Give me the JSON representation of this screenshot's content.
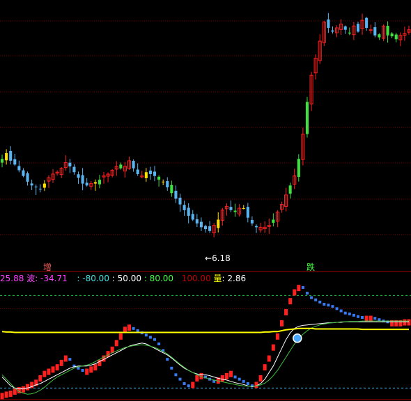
{
  "colors": {
    "background": "#000000",
    "grid": "#7a0000",
    "divider": "#a00000",
    "up": "#ff2020",
    "down": "#5ab4f0",
    "highlight_yellow": "#ffe000",
    "highlight_green": "#40e040",
    "white_line": "#ffffff",
    "green_line": "#40c040",
    "yellow_line": "#ffff00",
    "level_green": "#20c040",
    "level_cyan": "#40c0ff",
    "label_magenta": "#ff40ff",
    "label_cyan": "#40e0e0",
    "label_white": "#ffffff",
    "label_green": "#40ff40",
    "label_red": "#c00000"
  },
  "price_panel": {
    "min_price_label": "6.18",
    "min_marker": "←"
  },
  "signals": {
    "increase_label": "增",
    "fall_label": "跌"
  },
  "indicator_header": {
    "value1": "25.88",
    "wave_name": "波",
    "wave_value": ": -34.71",
    "level_m80": ": -80.00",
    "level_50": ": 50.00",
    "level_80": ": 80.00",
    "level_100": "100.00",
    "volume_name": "量",
    "volume_value": ": 2.86"
  },
  "chart_data": [
    {
      "type": "candlestick",
      "title": "",
      "y_min_marked": 6.18,
      "bars": 97,
      "closes": [
        10.2,
        10.5,
        10.1,
        9.9,
        9.6,
        9.3,
        9.0,
        8.8,
        8.7,
        8.6,
        8.9,
        9.2,
        9.4,
        9.5,
        9.7,
        10.0,
        9.8,
        9.5,
        9.2,
        8.9,
        8.8,
        8.9,
        8.9,
        9.1,
        9.3,
        9.4,
        9.6,
        9.8,
        9.7,
        9.8,
        10.1,
        9.7,
        9.4,
        9.3,
        9.5,
        9.4,
        9.3,
        9.1,
        9.0,
        8.7,
        8.4,
        8.1,
        7.8,
        7.5,
        7.2,
        7.0,
        6.8,
        6.6,
        6.5,
        6.4,
        6.7,
        7.0,
        7.5,
        7.7,
        7.5,
        7.4,
        7.6,
        7.6,
        7.1,
        6.8,
        6.6,
        6.6,
        6.6,
        6.7,
        7.0,
        7.4,
        7.8,
        8.3,
        8.8,
        9.3,
        10.2,
        11.5,
        13.2,
        14.6,
        15.5,
        16.4,
        17.4,
        17.1,
        16.9,
        17.1,
        17.3,
        17.0,
        16.8,
        17.2,
        16.9,
        17.5,
        17.1,
        17.0,
        16.7,
        16.6,
        17.2,
        16.7,
        16.8,
        16.5,
        16.7,
        16.8,
        17.0
      ]
    },
    {
      "type": "line",
      "title": "",
      "levels": [
        -80,
        50,
        80,
        100
      ],
      "series": [
        {
          "color": "histogram",
          "values": [
            -95,
            -92,
            -90,
            -85,
            -82,
            -80,
            -75,
            -70,
            -65,
            -55,
            -45,
            -40,
            -35,
            -30,
            -20,
            -10,
            -15,
            -30,
            -35,
            -40,
            -40,
            -35,
            -30,
            -20,
            -10,
            0,
            10,
            25,
            40,
            55,
            60,
            55,
            50,
            45,
            40,
            35,
            30,
            20,
            5,
            -15,
            -35,
            -50,
            -60,
            -70,
            -75,
            -70,
            -55,
            -50,
            -55,
            -60,
            -65,
            -60,
            -55,
            -50,
            -45,
            -55,
            -60,
            -65,
            -70,
            -75,
            -70,
            -55,
            -30,
            -10,
            15,
            40,
            70,
            95,
            120,
            140,
            150,
            148,
            135,
            125,
            120,
            115,
            110,
            108,
            105,
            100,
            95,
            90,
            88,
            85,
            82,
            80,
            80,
            80,
            78,
            75,
            72,
            70,
            70,
            70,
            70,
            72,
            72
          ]
        },
        {
          "color": "white",
          "values": [
            -55,
            -65,
            -75,
            -80,
            -82,
            -82,
            -80,
            -77,
            -73,
            -70,
            -65,
            -60,
            -55,
            -50,
            -45,
            -40,
            -35,
            -32,
            -30,
            -30,
            -30,
            -28,
            -25,
            -20,
            -15,
            -10,
            -5,
            0,
            5,
            10,
            15,
            18,
            20,
            22,
            20,
            15,
            10,
            5,
            0,
            -5,
            -12,
            -20,
            -28,
            -35,
            -40,
            -45,
            -48,
            -50,
            -50,
            -52,
            -55,
            -58,
            -60,
            -62,
            -65,
            -68,
            -70,
            -72,
            -75,
            -77,
            -75,
            -70,
            -60,
            -45,
            -30,
            -10,
            10,
            30,
            45,
            55,
            60,
            62,
            63,
            64,
            65,
            66,
            67,
            68,
            68,
            69,
            69,
            70,
            70,
            70,
            70,
            70,
            70,
            70,
            70,
            70,
            70,
            70,
            70,
            70,
            70,
            70,
            70
          ]
        },
        {
          "color": "green",
          "values": [
            -50,
            -60,
            -70,
            -80,
            -88,
            -92,
            -94,
            -93,
            -90,
            -85,
            -78,
            -70,
            -62,
            -55,
            -50,
            -45,
            -40,
            -35,
            -32,
            -30,
            -28,
            -25,
            -20,
            -15,
            -10,
            -5,
            0,
            4,
            8,
            12,
            14,
            16,
            17,
            18,
            17,
            15,
            12,
            8,
            3,
            -3,
            -10,
            -18,
            -26,
            -33,
            -40,
            -45,
            -50,
            -54,
            -57,
            -60,
            -62,
            -64,
            -66,
            -68,
            -70,
            -72,
            -74,
            -75,
            -76,
            -76,
            -75,
            -73,
            -69,
            -62,
            -52,
            -40,
            -25,
            -10,
            5,
            20,
            32,
            42,
            50,
            56,
            60,
            63,
            65,
            67,
            68,
            69,
            70,
            70,
            71,
            71,
            71,
            72,
            72,
            72,
            72,
            72,
            72,
            72,
            72,
            72,
            72,
            72,
            72
          ]
        },
        {
          "color": "yellow",
          "values": [
            48,
            47,
            47,
            46,
            46,
            46,
            46,
            46,
            46,
            46,
            46,
            46,
            46,
            46,
            46,
            46,
            46,
            46,
            46,
            46,
            46,
            46,
            46,
            46,
            46,
            46,
            46,
            46,
            46,
            46,
            46,
            46,
            46,
            46,
            46,
            46,
            46,
            46,
            46,
            46,
            46,
            46,
            46,
            46,
            46,
            46,
            46,
            46,
            46,
            46,
            46,
            46,
            46,
            46,
            46,
            46,
            46,
            46,
            46,
            46,
            46,
            46,
            47,
            47,
            48,
            48,
            50,
            52,
            53,
            54,
            55,
            55,
            55,
            55,
            54,
            54,
            54,
            54,
            54,
            54,
            54,
            54,
            54,
            54,
            54,
            53,
            53,
            53,
            53,
            53,
            53,
            53,
            53,
            53,
            53,
            53,
            53
          ]
        }
      ]
    }
  ]
}
